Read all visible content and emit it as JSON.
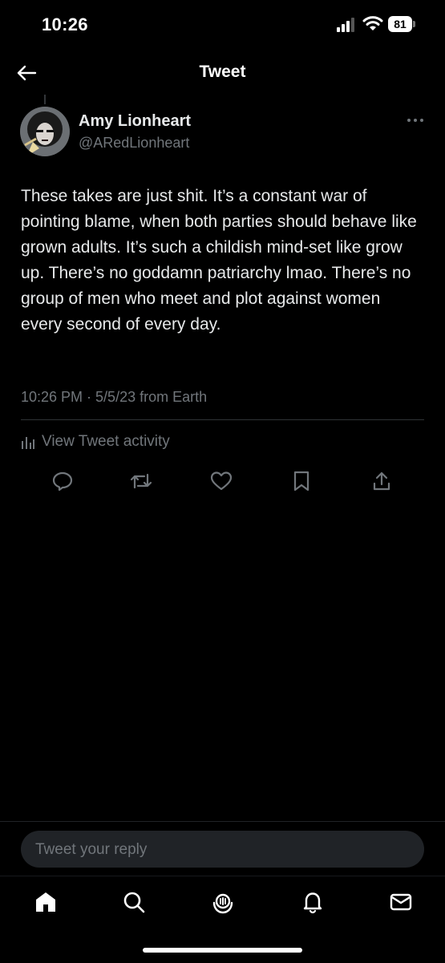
{
  "status_bar": {
    "time": "10:26",
    "battery": "81"
  },
  "header": {
    "title": "Tweet",
    "back_icon": "arrow-left-icon"
  },
  "tweet": {
    "author_name": "Amy Lionheart",
    "author_handle": "@ARedLionheart",
    "text": "These takes are just shit. It’s a constant war of pointing blame, when both parties should behave like grown adults. It’s such a childish mind-set like grow up. There’s no goddamn patriarchy lmao. There’s no group of men who meet and plot against women every second of every day.",
    "meta": "10:26 PM · 5/5/23 from Earth",
    "activity_label": "View Tweet activity",
    "actions": [
      "reply-icon",
      "retweet-icon",
      "like-icon",
      "bookmark-icon",
      "share-icon"
    ]
  },
  "reply": {
    "placeholder": "Tweet your reply"
  },
  "tabbar": {
    "items": [
      "home-icon",
      "search-icon",
      "spaces-icon",
      "notifications-icon",
      "messages-icon"
    ]
  },
  "colors": {
    "background": "#000000",
    "text": "#e7e9ea",
    "secondary": "#71767b",
    "input_bg": "#202327"
  }
}
